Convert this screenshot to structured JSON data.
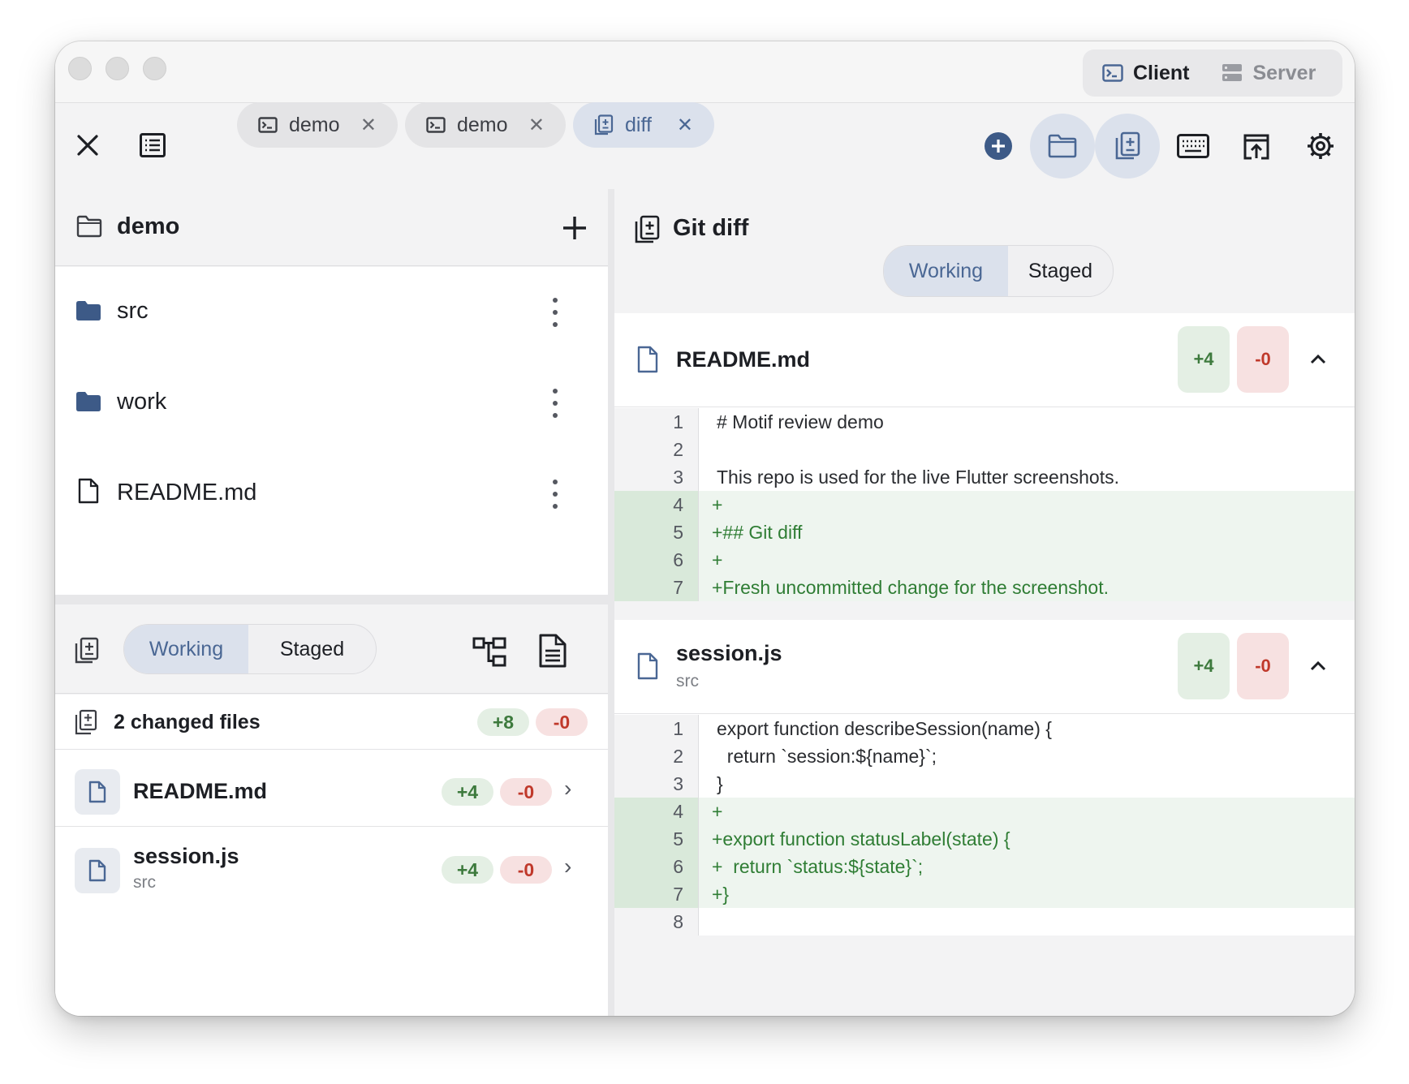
{
  "titlebar": {
    "mode_client": "Client",
    "mode_server": "Server"
  },
  "tabs": [
    {
      "label": "demo",
      "icon": "terminal-icon",
      "active": false
    },
    {
      "label": "demo",
      "icon": "terminal-icon",
      "active": false
    },
    {
      "label": "diff",
      "icon": "diff-icon",
      "active": true
    }
  ],
  "toolbar_icons": [
    "close-icon",
    "list-icon",
    "add-icon",
    "folder-icon",
    "diff-icon",
    "keyboard-icon",
    "upload-icon",
    "gear-icon"
  ],
  "project": {
    "name": "demo",
    "files": [
      {
        "name": "src",
        "type": "folder"
      },
      {
        "name": "work",
        "type": "folder"
      },
      {
        "name": "README.md",
        "type": "file"
      }
    ]
  },
  "git_panel": {
    "working_label": "Working",
    "staged_label": "Staged",
    "changed_summary": "2 changed files",
    "total_added": "+8",
    "total_removed": "-0",
    "files": [
      {
        "name": "README.md",
        "dir": "",
        "added": "+4",
        "removed": "-0"
      },
      {
        "name": "session.js",
        "dir": "src",
        "added": "+4",
        "removed": "-0"
      }
    ]
  },
  "diff_view": {
    "title": "Git diff",
    "working_label": "Working",
    "staged_label": "Staged",
    "files": [
      {
        "name": "README.md",
        "dir": "",
        "added": "+4",
        "removed": "-0",
        "lines": [
          {
            "n": "1",
            "text": "# Motif review demo",
            "kind": "context"
          },
          {
            "n": "2",
            "text": "",
            "kind": "context"
          },
          {
            "n": "3",
            "text": "This repo is used for the live Flutter screenshots.",
            "kind": "context"
          },
          {
            "n": "4",
            "text": "+",
            "kind": "added"
          },
          {
            "n": "5",
            "text": "+## Git diff",
            "kind": "added"
          },
          {
            "n": "6",
            "text": "+",
            "kind": "added"
          },
          {
            "n": "7",
            "text": "+Fresh uncommitted change for the screenshot.",
            "kind": "added"
          }
        ]
      },
      {
        "name": "session.js",
        "dir": "src",
        "added": "+4",
        "removed": "-0",
        "lines": [
          {
            "n": "1",
            "text": "export function describeSession(name) {",
            "kind": "context"
          },
          {
            "n": "2",
            "text": "  return `session:${name}`;",
            "kind": "context"
          },
          {
            "n": "3",
            "text": "}",
            "kind": "context"
          },
          {
            "n": "4",
            "text": "+",
            "kind": "added"
          },
          {
            "n": "5",
            "text": "+export function statusLabel(state) {",
            "kind": "added"
          },
          {
            "n": "6",
            "text": "+  return `status:${state}`;",
            "kind": "added"
          },
          {
            "n": "7",
            "text": "+}",
            "kind": "added"
          },
          {
            "n": "8",
            "text": "",
            "kind": "context"
          }
        ]
      }
    ]
  },
  "colors": {
    "accent": "#4a6794",
    "accent_bg": "#dbe1ec",
    "added_text": "#2f7d34",
    "added_bg": "#eef5ef",
    "removed_text": "#c0392b",
    "removed_bg": "#f7e1e1",
    "folder": "#3d5a87"
  }
}
